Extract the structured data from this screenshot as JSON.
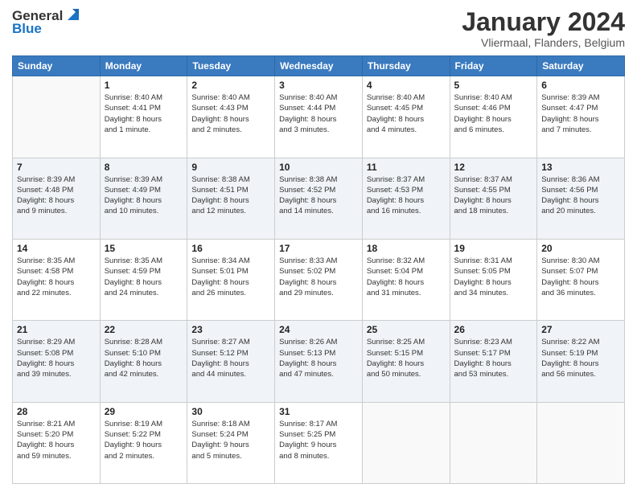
{
  "logo": {
    "line1": "General",
    "line2": "Blue"
  },
  "header": {
    "month": "January 2024",
    "location": "Vliermaal, Flanders, Belgium"
  },
  "weekdays": [
    "Sunday",
    "Monday",
    "Tuesday",
    "Wednesday",
    "Thursday",
    "Friday",
    "Saturday"
  ],
  "weeks": [
    [
      {
        "day": "",
        "info": ""
      },
      {
        "day": "1",
        "info": "Sunrise: 8:40 AM\nSunset: 4:41 PM\nDaylight: 8 hours\nand 1 minute."
      },
      {
        "day": "2",
        "info": "Sunrise: 8:40 AM\nSunset: 4:43 PM\nDaylight: 8 hours\nand 2 minutes."
      },
      {
        "day": "3",
        "info": "Sunrise: 8:40 AM\nSunset: 4:44 PM\nDaylight: 8 hours\nand 3 minutes."
      },
      {
        "day": "4",
        "info": "Sunrise: 8:40 AM\nSunset: 4:45 PM\nDaylight: 8 hours\nand 4 minutes."
      },
      {
        "day": "5",
        "info": "Sunrise: 8:40 AM\nSunset: 4:46 PM\nDaylight: 8 hours\nand 6 minutes."
      },
      {
        "day": "6",
        "info": "Sunrise: 8:39 AM\nSunset: 4:47 PM\nDaylight: 8 hours\nand 7 minutes."
      }
    ],
    [
      {
        "day": "7",
        "info": "Sunrise: 8:39 AM\nSunset: 4:48 PM\nDaylight: 8 hours\nand 9 minutes."
      },
      {
        "day": "8",
        "info": "Sunrise: 8:39 AM\nSunset: 4:49 PM\nDaylight: 8 hours\nand 10 minutes."
      },
      {
        "day": "9",
        "info": "Sunrise: 8:38 AM\nSunset: 4:51 PM\nDaylight: 8 hours\nand 12 minutes."
      },
      {
        "day": "10",
        "info": "Sunrise: 8:38 AM\nSunset: 4:52 PM\nDaylight: 8 hours\nand 14 minutes."
      },
      {
        "day": "11",
        "info": "Sunrise: 8:37 AM\nSunset: 4:53 PM\nDaylight: 8 hours\nand 16 minutes."
      },
      {
        "day": "12",
        "info": "Sunrise: 8:37 AM\nSunset: 4:55 PM\nDaylight: 8 hours\nand 18 minutes."
      },
      {
        "day": "13",
        "info": "Sunrise: 8:36 AM\nSunset: 4:56 PM\nDaylight: 8 hours\nand 20 minutes."
      }
    ],
    [
      {
        "day": "14",
        "info": "Sunrise: 8:35 AM\nSunset: 4:58 PM\nDaylight: 8 hours\nand 22 minutes."
      },
      {
        "day": "15",
        "info": "Sunrise: 8:35 AM\nSunset: 4:59 PM\nDaylight: 8 hours\nand 24 minutes."
      },
      {
        "day": "16",
        "info": "Sunrise: 8:34 AM\nSunset: 5:01 PM\nDaylight: 8 hours\nand 26 minutes."
      },
      {
        "day": "17",
        "info": "Sunrise: 8:33 AM\nSunset: 5:02 PM\nDaylight: 8 hours\nand 29 minutes."
      },
      {
        "day": "18",
        "info": "Sunrise: 8:32 AM\nSunset: 5:04 PM\nDaylight: 8 hours\nand 31 minutes."
      },
      {
        "day": "19",
        "info": "Sunrise: 8:31 AM\nSunset: 5:05 PM\nDaylight: 8 hours\nand 34 minutes."
      },
      {
        "day": "20",
        "info": "Sunrise: 8:30 AM\nSunset: 5:07 PM\nDaylight: 8 hours\nand 36 minutes."
      }
    ],
    [
      {
        "day": "21",
        "info": "Sunrise: 8:29 AM\nSunset: 5:08 PM\nDaylight: 8 hours\nand 39 minutes."
      },
      {
        "day": "22",
        "info": "Sunrise: 8:28 AM\nSunset: 5:10 PM\nDaylight: 8 hours\nand 42 minutes."
      },
      {
        "day": "23",
        "info": "Sunrise: 8:27 AM\nSunset: 5:12 PM\nDaylight: 8 hours\nand 44 minutes."
      },
      {
        "day": "24",
        "info": "Sunrise: 8:26 AM\nSunset: 5:13 PM\nDaylight: 8 hours\nand 47 minutes."
      },
      {
        "day": "25",
        "info": "Sunrise: 8:25 AM\nSunset: 5:15 PM\nDaylight: 8 hours\nand 50 minutes."
      },
      {
        "day": "26",
        "info": "Sunrise: 8:23 AM\nSunset: 5:17 PM\nDaylight: 8 hours\nand 53 minutes."
      },
      {
        "day": "27",
        "info": "Sunrise: 8:22 AM\nSunset: 5:19 PM\nDaylight: 8 hours\nand 56 minutes."
      }
    ],
    [
      {
        "day": "28",
        "info": "Sunrise: 8:21 AM\nSunset: 5:20 PM\nDaylight: 8 hours\nand 59 minutes."
      },
      {
        "day": "29",
        "info": "Sunrise: 8:19 AM\nSunset: 5:22 PM\nDaylight: 9 hours\nand 2 minutes."
      },
      {
        "day": "30",
        "info": "Sunrise: 8:18 AM\nSunset: 5:24 PM\nDaylight: 9 hours\nand 5 minutes."
      },
      {
        "day": "31",
        "info": "Sunrise: 8:17 AM\nSunset: 5:25 PM\nDaylight: 9 hours\nand 8 minutes."
      },
      {
        "day": "",
        "info": ""
      },
      {
        "day": "",
        "info": ""
      },
      {
        "day": "",
        "info": ""
      }
    ]
  ]
}
